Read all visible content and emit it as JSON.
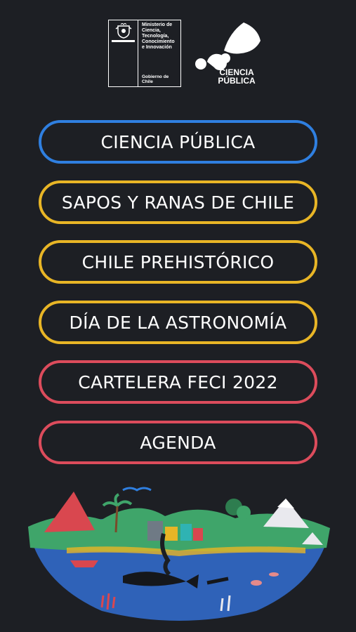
{
  "header": {
    "gobierno_logo": {
      "ministry_text": "Ministerio de\nCiencia,\nTecnología,\nConocimiento\ne Innovación",
      "footer_text": "Gobierno de Chile"
    },
    "ciencia_publica_logo": {
      "text": "CIENCIA\nPÚBLICA"
    }
  },
  "menu": {
    "items": [
      {
        "label": "CIENCIA PÚBLICA",
        "border_color": "#2f7fe0"
      },
      {
        "label": "SAPOS Y RANAS DE CHILE",
        "border_color": "#e8b526"
      },
      {
        "label": "CHILE PREHISTÓRICO",
        "border_color": "#e8b526"
      },
      {
        "label": "DÍA DE LA ASTRONOMÍA",
        "border_color": "#e8b526"
      },
      {
        "label": "CARTELERA FECI 2022",
        "border_color": "#dc4c5c"
      },
      {
        "label": "AGENDA",
        "border_color": "#dc4c5c"
      }
    ]
  },
  "colors": {
    "background": "#1d1f24",
    "ocean": "#2f62b8",
    "land_green": "#3fa56a"
  }
}
